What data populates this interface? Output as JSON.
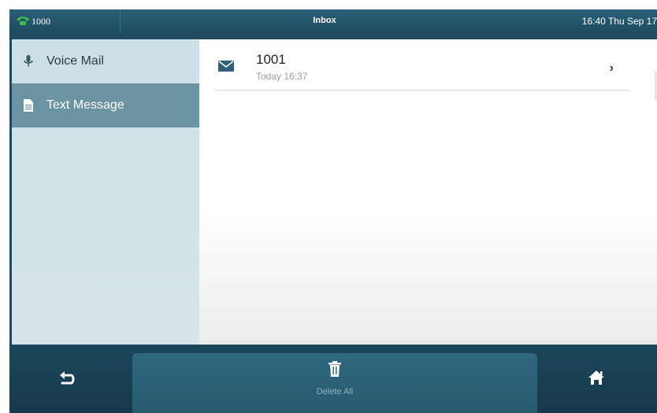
{
  "status_bar": {
    "line_label": "1000",
    "title": "Inbox",
    "datetime": "16:40 Thu Sep 17",
    "line_icon": "phone-icon"
  },
  "sidebar": {
    "items": [
      {
        "label": "Voice Mail",
        "icon": "microphone-icon",
        "active": false
      },
      {
        "label": "Text Message",
        "icon": "document-icon",
        "active": true
      }
    ]
  },
  "messages": [
    {
      "sender": "1001",
      "time": "Today 16:37",
      "icon": "envelope-icon"
    }
  ],
  "bottom_bar": {
    "back_icon": "back-arrow-icon",
    "delete_all_label": "Delete All",
    "delete_icon": "trash-icon",
    "home_icon": "home-icon"
  },
  "colors": {
    "status_bar": "#1d4b61",
    "sidebar_bg": "#d0e1e8",
    "sidebar_active": "#6c93a2",
    "line_icon": "#3fbf4a",
    "bottom_bar": "#163a4c",
    "delete_button": "#2b6078"
  }
}
